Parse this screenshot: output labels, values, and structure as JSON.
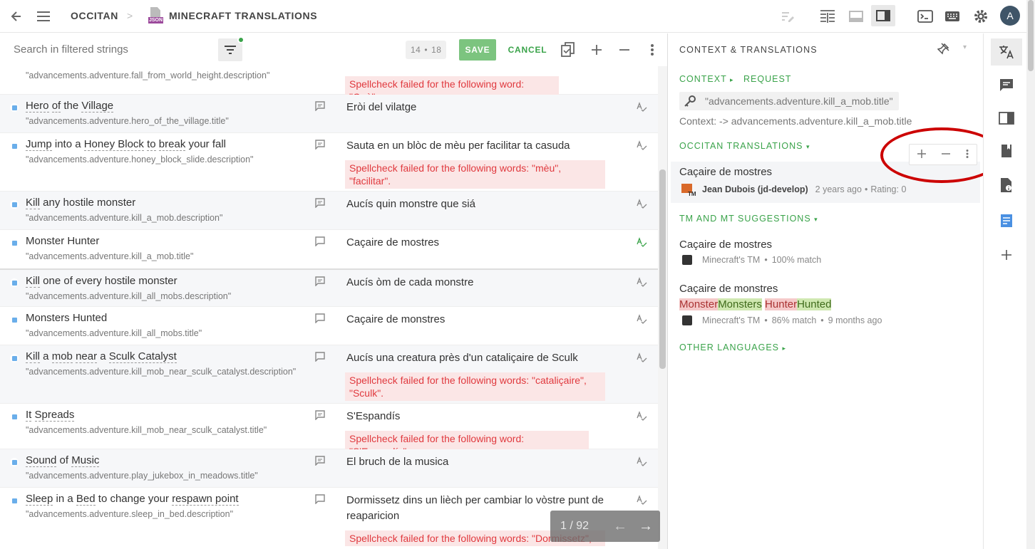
{
  "header": {
    "project": "OCCITAN",
    "separator": ">",
    "file_badge": "JSON",
    "resource": "MINECRAFT TRANSLATIONS",
    "avatar": "A"
  },
  "toolbar": {
    "search_placeholder": "Search in filtered strings",
    "counter_a": "14",
    "counter_sep": "•",
    "counter_b": "18",
    "save_label": "SAVE",
    "cancel_label": "CANCEL"
  },
  "rows": [
    {
      "source": "",
      "key": "\"advancements.adventure.fall_from_world_height.description\"",
      "target": "",
      "error": "Spellcheck failed for the following word: \"Què\"."
    },
    {
      "source_parts": [
        "Hero",
        " ",
        "of",
        " the ",
        "Village"
      ],
      "key": "\"advancements.adventure.hero_of_the_village.title\"",
      "target": "Eròi del vilatge"
    },
    {
      "source_parts": [
        "Jump",
        " into a ",
        "Honey Block",
        " ",
        "to",
        " ",
        "break",
        " your fall"
      ],
      "key": "\"advancements.adventure.honey_block_slide.description\"",
      "target": "Sauta en un blòc de mèu per facilitar ta casuda",
      "error": "Spellcheck failed for the following words: \"mèu\", \"facilitar\"."
    },
    {
      "source_parts": [
        "Kill",
        " any hostile monster"
      ],
      "key": "\"advancements.adventure.kill_a_mob.description\"",
      "target": "Aucís quin monstre que siá"
    },
    {
      "source": "Monster Hunter",
      "key": "\"advancements.adventure.kill_a_mob.title\"",
      "target": "Caçaire de mostres"
    },
    {
      "source_parts": [
        "Kill",
        " one of every hostile monster"
      ],
      "key": "\"advancements.adventure.kill_all_mobs.description\"",
      "target": "Aucís òm de cada monstre"
    },
    {
      "source": "Monsters Hunted",
      "key": "\"advancements.adventure.kill_all_mobs.title\"",
      "target": "Caçaire de monstres"
    },
    {
      "source_parts": [
        "Kill",
        " a ",
        "mob",
        " ",
        "near",
        " a ",
        "Sculk Catalyst"
      ],
      "key": "\"advancements.adventure.kill_mob_near_sculk_catalyst.description\"",
      "target": "Aucís una creatura près d'un cataliçaire de Sculk",
      "error": "Spellcheck failed for the following words: \"cataliçaire\", \"Sculk\"."
    },
    {
      "source_parts": [
        "It",
        " ",
        "Spreads"
      ],
      "key": "\"advancements.adventure.kill_mob_near_sculk_catalyst.title\"",
      "target": "S'Espandís",
      "error": "Spellcheck failed for the following word: \"S'Espandís\"."
    },
    {
      "source_parts": [
        "Sound",
        " of ",
        "Music"
      ],
      "key": "\"advancements.adventure.play_jukebox_in_meadows.title\"",
      "target": "El bruch de la musica"
    },
    {
      "source_parts": [
        "Sleep",
        " in a ",
        "Bed",
        " to change your ",
        "respawn point"
      ],
      "key": "\"advancements.adventure.sleep_in_bed.description\"",
      "target": "Dormissetz dins un lièch per cambiar lo vòstre punt de reaparicion",
      "error": "Spellcheck failed for the following words: \"Dormissetz\","
    }
  ],
  "pager": {
    "text": "1 / 92"
  },
  "context": {
    "title": "CONTEXT & TRANSLATIONS",
    "context_tab": "CONTEXT",
    "request_tab": "REQUEST",
    "key": "\"advancements.adventure.kill_a_mob.title\"",
    "context_line": "Context: -> advancements.adventure.kill_a_mob.title"
  },
  "translations": {
    "header": "OCCITAN TRANSLATIONS",
    "text": "Caçaire de mostres",
    "tm_badge": "TM",
    "author": "Jean Dubois (jd-develop)",
    "time": "2 years ago",
    "dot": "•",
    "rating": "Rating: 0"
  },
  "suggestions": {
    "header": "TM AND MT SUGGESTIONS",
    "items": [
      {
        "text": "Caçaire de mostres",
        "source": "Minecraft's TM",
        "match": "100% match"
      },
      {
        "text": "Caçaire de monstres",
        "source": "Minecraft's TM",
        "match": "86% match",
        "time": "9 months ago"
      }
    ],
    "diff": [
      {
        "del": "Monster",
        "ins": "Monsters"
      },
      {
        "del": "Hunter",
        "ins": "Hunted"
      }
    ]
  },
  "other_languages": "OTHER LANGUAGES"
}
